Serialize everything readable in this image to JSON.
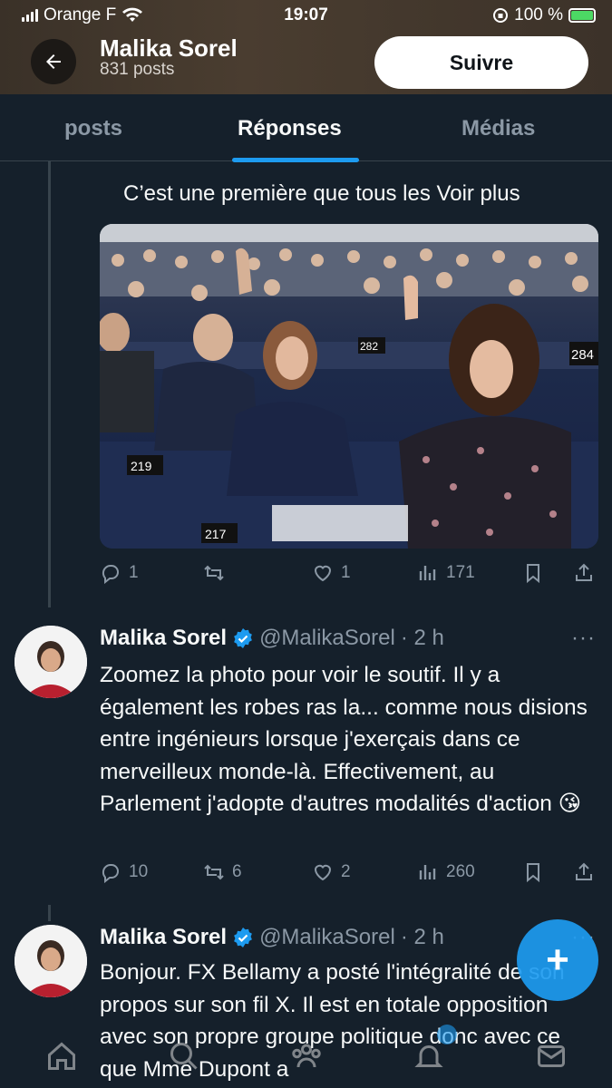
{
  "status_bar": {
    "carrier": "Orange F",
    "time": "19:07",
    "battery": "100 %"
  },
  "header": {
    "name": "Malika Sorel",
    "post_count": "831 posts",
    "follow_label": "Suivre"
  },
  "tabs": [
    {
      "label": "posts",
      "active": false
    },
    {
      "label": "Réponses",
      "active": true
    },
    {
      "label": "Médias",
      "active": false
    }
  ],
  "quoted_post": {
    "text": "C’est une première que tous les",
    "more_label": "Voir plus",
    "image_desc": "parliament-vote-photo",
    "seat_numbers": [
      "219",
      "217",
      "282",
      "284"
    ],
    "stats": {
      "replies": "1",
      "reposts": "",
      "likes": "1",
      "views": "171"
    }
  },
  "replies": [
    {
      "name": "Malika Sorel",
      "handle": "@MalikaSorel",
      "time": "· 2 h",
      "body": "Zoomez la photo pour voir le soutif. Il y a également les robes ras la... comme nous disions entre ingénieurs lorsque j'exerçais dans ce merveilleux monde-là. Effectivement, au Parlement j'adopte d'autres modalités d'action 😘",
      "stats": {
        "replies": "10",
        "reposts": "6",
        "likes": "2",
        "views": "260"
      }
    },
    {
      "name": "Malika Sorel",
      "handle": "@MalikaSorel",
      "time": "· 2 h",
      "body": "Bonjour. FX Bellamy a posté l'intégralité de son propos sur son fil X. Il est en totale opposition avec son propre groupe politique donc avec ce que Mme Dupont a"
    }
  ],
  "fab_label": "+",
  "colors": {
    "background": "#15202b",
    "accent": "#1d9bf0",
    "muted": "#8b98a5"
  }
}
